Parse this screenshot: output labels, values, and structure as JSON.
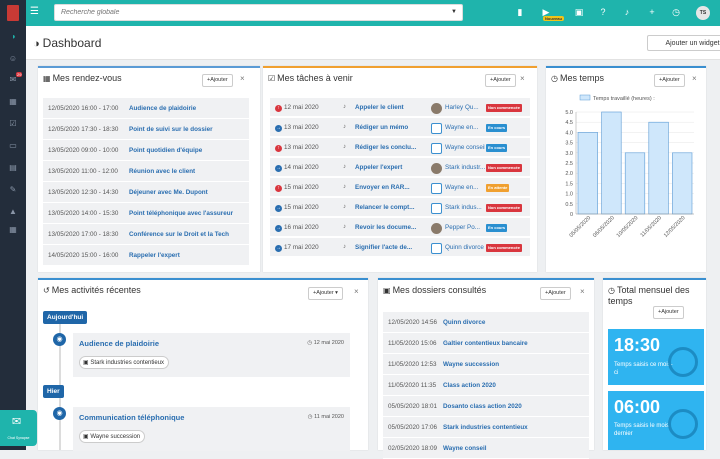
{
  "topbar": {
    "search_placeholder": "Recherche globale",
    "nouveau_badge": "Nouveau",
    "avatar_initials": "TS"
  },
  "header": {
    "title": "Dashboard",
    "add_widget": "Ajouter un widget"
  },
  "sidebar": {
    "badge": "29"
  },
  "chat": {
    "label": "Chat Synapse"
  },
  "rdv": {
    "title": "Mes rendez-vous",
    "add": "Ajouter",
    "items": [
      {
        "date": "12/05/2020 16:00 - 17:00",
        "label": "Audience de plaidoirie"
      },
      {
        "date": "12/05/2020 17:30 - 18:30",
        "label": "Point de suivi sur le dossier"
      },
      {
        "date": "13/05/2020 09:00 - 10:00",
        "label": "Point quotidien d'équipe"
      },
      {
        "date": "13/05/2020 11:00 - 12:00",
        "label": "Réunion avec le client"
      },
      {
        "date": "13/05/2020 12:30 - 14:30",
        "label": "Déjeuner avec Me. Dupont"
      },
      {
        "date": "13/05/2020 14:00 - 15:30",
        "label": "Point téléphonique avec l'assureur"
      },
      {
        "date": "13/05/2020 17:00 - 18:30",
        "label": "Conférence sur le Droit et la Tech"
      },
      {
        "date": "14/05/2020 15:00 - 16:00",
        "label": "Rappeler l'expert"
      }
    ]
  },
  "tasks": {
    "title": "Mes tâches à venir",
    "add": "Ajouter",
    "items": [
      {
        "status": "red",
        "date": "12 mai 2020",
        "label": "Appeler le client",
        "contact": "Harley Qu...",
        "badge": "Non commencée",
        "badge_color": "#d9363e"
      },
      {
        "status": "blue",
        "date": "13 mai 2020",
        "label": "Rédiger un mémo",
        "contact": "Wayne en...",
        "badge": "En cours",
        "badge_color": "#2a8fd0"
      },
      {
        "status": "red",
        "date": "13 mai 2020",
        "label": "Rédiger les conclu...",
        "contact": "Wayne conseil",
        "badge": "En cours",
        "badge_color": "#2a8fd0"
      },
      {
        "status": "blue",
        "date": "14 mai 2020",
        "label": "Appeler l'expert",
        "contact": "Stark industr...",
        "badge": "Non commencée",
        "badge_color": "#d9363e"
      },
      {
        "status": "red",
        "date": "15 mai 2020",
        "label": "Envoyer en RAR...",
        "contact": "Wayne en...",
        "badge": "En attente",
        "badge_color": "#f0a030"
      },
      {
        "status": "blue",
        "date": "15 mai 2020",
        "label": "Relancer le compt...",
        "contact": "Stark indus...",
        "badge": "Non commencée",
        "badge_color": "#d9363e"
      },
      {
        "status": "blue",
        "date": "16 mai 2020",
        "label": "Revoir les docume...",
        "contact": "Pepper Po...",
        "badge": "En cours",
        "badge_color": "#2a8fd0"
      },
      {
        "status": "blue",
        "date": "17 mai 2020",
        "label": "Signifier l'acte de...",
        "contact": "Quinn divorce",
        "badge": "Non commencée",
        "badge_color": "#d9363e"
      }
    ]
  },
  "temps": {
    "title": "Mes temps",
    "add": "Ajouter"
  },
  "chart_data": {
    "type": "bar",
    "legend": "Temps travaillé (heures) :",
    "categories": [
      "05/05/2020",
      "06/05/2020",
      "10/05/2020",
      "11/05/2020",
      "12/05/2020"
    ],
    "values": [
      4.0,
      5.0,
      3.0,
      4.5,
      3.0
    ],
    "ylim": [
      0,
      5.0
    ],
    "yticks": [
      "0",
      "0.5",
      "1.0",
      "1.5",
      "2.0",
      "2.5",
      "3.0",
      "3.5",
      "4.0",
      "4.5",
      "5.0"
    ]
  },
  "activities": {
    "title": "Mes activités récentes",
    "add": "Ajouter",
    "groups": [
      {
        "badge": "Aujourd'hui",
        "title": "Audience de plaidoirie",
        "date": "12 mai 2020",
        "tag": "Stark industries contentieux"
      },
      {
        "badge": "Hier",
        "title": "Communication téléphonique",
        "date": "11 mai 2020",
        "tag": "Wayne succession"
      }
    ]
  },
  "dossiers": {
    "title": "Mes dossiers consultés",
    "add": "Ajouter",
    "items": [
      {
        "date": "12/05/2020 14:56",
        "label": "Quinn divorce"
      },
      {
        "date": "11/05/2020 15:06",
        "label": "Galtier contentieux bancaire"
      },
      {
        "date": "11/05/2020 12:53",
        "label": "Wayne succession"
      },
      {
        "date": "11/05/2020 11:35",
        "label": "Class action 2020"
      },
      {
        "date": "05/05/2020 18:01",
        "label": "Dosanto class action 2020"
      },
      {
        "date": "05/05/2020 17:06",
        "label": "Stark industries contentieux"
      },
      {
        "date": "02/05/2020 18:09",
        "label": "Wayne conseil"
      }
    ]
  },
  "total": {
    "title": "Total mensuel des temps",
    "add": "Ajouter",
    "stats": [
      {
        "value": "18:30",
        "label": "Temps saisis ce mois-ci"
      },
      {
        "value": "06:00",
        "label": "Temps saisis le mois dernier"
      }
    ]
  }
}
